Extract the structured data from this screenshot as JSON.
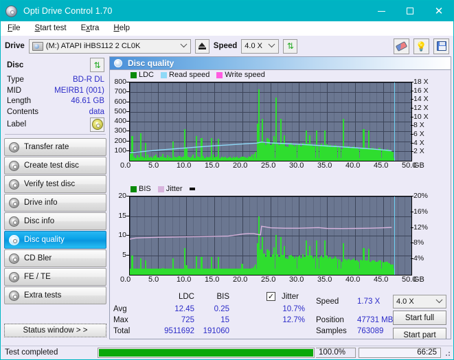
{
  "window": {
    "title": "Opti Drive Control 1.70",
    "icon": "disc-icon",
    "minimize": "–",
    "maximize": "□",
    "close": "✕"
  },
  "menu": {
    "items": [
      "File",
      "Start test",
      "Extra",
      "Help"
    ]
  },
  "toolbar": {
    "drive_label": "Drive",
    "drive_value": "(M:)  ATAPI iHBS112  2 CL0K",
    "eject_icon": "eject-icon",
    "speed_label": "Speed",
    "speed_value": "4.0 X",
    "refresh_icon": "refresh-icon",
    "eraser_icon": "eraser-icon",
    "bulb_icon": "bulb-icon",
    "save_icon": "save-icon"
  },
  "disc": {
    "heading": "Disc",
    "refresh_icon": "refresh-icon",
    "rows": [
      {
        "key": "Type",
        "value": "BD-R DL"
      },
      {
        "key": "MID",
        "value": "MEIRB1 (001)"
      },
      {
        "key": "Length",
        "value": "46.61 GB"
      },
      {
        "key": "Contents",
        "value": "data"
      }
    ],
    "label_key": "Label",
    "label_icon": "cd-disc-icon"
  },
  "nav": {
    "items": [
      {
        "label": "Transfer rate",
        "active": false
      },
      {
        "label": "Create test disc",
        "active": false
      },
      {
        "label": "Verify test disc",
        "active": false
      },
      {
        "label": "Drive info",
        "active": false
      },
      {
        "label": "Disc info",
        "active": false
      },
      {
        "label": "Disc quality",
        "active": true
      },
      {
        "label": "CD Bler",
        "active": false
      },
      {
        "label": "FE / TE",
        "active": false
      },
      {
        "label": "Extra tests",
        "active": false
      }
    ],
    "status_window": "Status window > >"
  },
  "panel": {
    "title": "Disc quality",
    "icon": "disc-quality-icon"
  },
  "stats": {
    "col_ldc": "LDC",
    "col_bis": "BIS",
    "jitter_label": "Jitter",
    "jitter_checked": true,
    "jitter_check_glyph": "✓",
    "row_avg": "Avg",
    "row_max": "Max",
    "row_total": "Total",
    "avg_ldc": "12.45",
    "avg_bis": "0.25",
    "avg_jitter": "10.7%",
    "max_ldc": "725",
    "max_bis": "15",
    "max_jitter": "12.7%",
    "total_ldc": "9511692",
    "total_bis": "191060",
    "speed_label": "Speed",
    "speed_value": "1.73 X",
    "position_label": "Position",
    "position_value": "47731 MB",
    "samples_label": "Samples",
    "samples_value": "763089",
    "speed_select": "4.0 X",
    "start_full": "Start full",
    "start_part": "Start part"
  },
  "statusbar": {
    "text": "Test completed",
    "progress_pct": "100.0%",
    "progress_value": 100,
    "time": "66:25"
  },
  "colors": {
    "accent": "#00b3c3",
    "plot_bg": "#6b7791",
    "ldc_green": "#2fdd2f",
    "read_speed": "#8fd9f7",
    "write_speed": "#ff5ce0",
    "jitter_pink": "#d8b4dd",
    "value_blue": "#2b2bc8",
    "progress_green": "#0aa80a"
  },
  "chart_data": [
    {
      "type": "bar",
      "id": "ldc-chart",
      "title": "Disc quality",
      "xlabel": "GB",
      "ylabel": "LDC",
      "xlim": [
        0,
        50
      ],
      "ylim": [
        0,
        800
      ],
      "y2lim": [
        0,
        18
      ],
      "y2label": "X",
      "xticks": [
        "0.0",
        "5.0",
        "10.0",
        "15.0",
        "20.0",
        "25.0",
        "30.0",
        "35.0",
        "40.0",
        "45.0",
        "50.0"
      ],
      "yticks": [
        100,
        200,
        300,
        400,
        500,
        600,
        700,
        800
      ],
      "y2ticks": [
        "2 X",
        "4 X",
        "6 X",
        "8 X",
        "10 X",
        "12 X",
        "14 X",
        "16 X",
        "18 X"
      ],
      "xunit": "GB",
      "grid": true,
      "legend": [
        {
          "name": "LDC",
          "color": "#0a8a0a",
          "type": "bar"
        },
        {
          "name": "Read speed",
          "color": "#8fd9f7",
          "type": "line"
        },
        {
          "name": "Write speed",
          "color": "#ff5ce0",
          "type": "line"
        }
      ],
      "legend_position": "top-left",
      "series": [
        {
          "name": "LDC",
          "type": "bar",
          "color": "#2fdd2f",
          "x_gb": [
            0.0,
            0.3,
            0.6,
            0.9,
            1.2,
            1.5,
            1.8,
            2.1,
            2.4,
            2.7,
            3.0,
            3.3,
            3.6,
            3.9,
            4.2,
            4.5,
            4.8,
            5.1,
            5.4,
            5.7,
            6.0,
            6.3,
            6.6,
            6.9,
            7.2,
            7.5,
            7.8,
            8.1,
            8.4,
            8.7,
            9.0,
            9.3,
            9.6,
            9.9,
            10.2,
            10.5,
            10.8,
            11.1,
            11.4,
            11.7,
            12.0,
            12.3,
            12.6,
            12.9,
            13.2,
            13.5,
            13.8,
            14.1,
            14.4,
            14.7,
            15.0,
            15.3,
            15.6,
            15.9,
            16.2,
            16.5,
            16.8,
            17.1,
            17.4,
            17.7,
            18.0,
            18.3,
            18.6,
            18.9,
            19.2,
            19.5,
            19.8,
            20.1,
            20.4,
            20.7,
            21.0,
            21.3,
            21.6,
            21.9,
            22.2,
            22.5,
            22.8,
            23.1,
            23.4,
            23.7,
            24.0,
            24.3,
            24.6,
            24.9,
            25.2,
            25.5,
            25.8,
            26.1,
            26.4,
            26.7,
            27.0,
            27.3,
            27.6,
            27.9,
            28.2,
            28.5,
            28.8,
            29.1,
            29.4,
            29.7,
            30.0,
            30.3,
            30.6,
            30.9,
            31.2,
            31.5,
            31.8,
            32.1,
            32.4,
            32.7,
            33.0,
            33.3,
            33.6,
            33.9,
            34.2,
            34.5,
            34.8,
            35.1,
            35.4,
            35.7,
            36.0,
            36.3,
            36.6,
            36.9,
            37.2,
            37.5,
            37.8,
            38.1,
            38.4,
            38.7,
            39.0,
            39.3,
            39.6,
            39.9,
            40.2,
            40.5,
            40.8,
            41.1,
            41.4,
            41.7,
            42.0,
            42.3,
            42.6,
            42.9,
            43.2,
            43.5,
            43.8,
            44.1,
            44.4,
            44.7,
            45.0,
            45.3,
            45.6,
            45.9,
            46.2,
            46.5
          ],
          "values": [
            70,
            250,
            40,
            30,
            55,
            35,
            280,
            45,
            30,
            180,
            60,
            35,
            40,
            30,
            50,
            60,
            35,
            30,
            45,
            70,
            35,
            30,
            55,
            40,
            30,
            200,
            45,
            35,
            40,
            50,
            35,
            40,
            320,
            130,
            45,
            35,
            40,
            60,
            30,
            250,
            40,
            35,
            230,
            50,
            30,
            40,
            35,
            45,
            230,
            60,
            35,
            40,
            225,
            30,
            45,
            35,
            40,
            30,
            35,
            40,
            30,
            45,
            35,
            40,
            30,
            35,
            45,
            40,
            35,
            30,
            40,
            45,
            60,
            70,
            90,
            380,
            730,
            200,
            430,
            190,
            160,
            230,
            215,
            160,
            185,
            250,
            645,
            185,
            160,
            430,
            180,
            260,
            150,
            140,
            175,
            180,
            165,
            150,
            170,
            160,
            175,
            150,
            185,
            160,
            310,
            175,
            260,
            170,
            150,
            165,
            310,
            150,
            160,
            175,
            155,
            310,
            170,
            150,
            160,
            140,
            150,
            165,
            150,
            140,
            130,
            120,
            430,
            140,
            130,
            145,
            125,
            135,
            150,
            125,
            130,
            120,
            135,
            125,
            320,
            130,
            125,
            310,
            120,
            130,
            125,
            115,
            120,
            130,
            125,
            120,
            110,
            115,
            120,
            100,
            95,
            90
          ]
        },
        {
          "name": "Read speed",
          "type": "line",
          "color": "#8fd9f7",
          "x_gb": [
            0,
            2.5,
            5,
            7.5,
            10,
            12.5,
            15,
            17.5,
            20,
            22.5,
            23.4,
            25,
            27.5,
            30,
            32.5,
            35,
            37.5,
            40,
            42.5,
            45,
            46.5
          ],
          "values_x": [
            1.85,
            2.15,
            2.45,
            2.7,
            2.95,
            3.2,
            3.45,
            3.65,
            3.85,
            4.05,
            4.3,
            4.1,
            3.95,
            3.8,
            3.6,
            3.4,
            3.2,
            3.0,
            2.75,
            2.5,
            2.3
          ]
        },
        {
          "name": "Write speed",
          "type": "line",
          "color": "#ff5ce0",
          "x_gb": [],
          "values_x": []
        },
        {
          "name": "End marker",
          "type": "vline",
          "color": "#6fd4f5",
          "x_gb": 46.9
        }
      ]
    },
    {
      "type": "bar",
      "id": "bis-chart",
      "xlabel": "GB",
      "ylabel": "BIS",
      "xlim": [
        0,
        50
      ],
      "ylim": [
        0,
        20
      ],
      "y2lim": [
        0,
        20
      ],
      "y2label": "%",
      "xticks": [
        "0.0",
        "5.0",
        "10.0",
        "15.0",
        "20.0",
        "25.0",
        "30.0",
        "35.0",
        "40.0",
        "45.0",
        "50.0"
      ],
      "yticks": [
        5,
        10,
        15,
        20
      ],
      "y2ticks": [
        "4%",
        "8%",
        "12%",
        "16%",
        "20%"
      ],
      "xunit": "GB",
      "grid": true,
      "legend": [
        {
          "name": "BIS",
          "color": "#0a8a0a",
          "type": "bar"
        },
        {
          "name": "Jitter",
          "color": "#d8b4dd",
          "type": "line"
        }
      ],
      "legend_position": "top-left",
      "series": [
        {
          "name": "BIS",
          "type": "bar",
          "color": "#2fdd2f",
          "x_gb": [
            0.0,
            0.3,
            0.6,
            0.9,
            1.2,
            1.5,
            1.8,
            2.1,
            2.4,
            2.7,
            3.0,
            3.3,
            3.6,
            3.9,
            4.2,
            4.5,
            4.8,
            5.1,
            5.4,
            5.7,
            6.0,
            6.3,
            6.6,
            6.9,
            7.2,
            7.5,
            7.8,
            8.1,
            8.4,
            8.7,
            9.0,
            9.3,
            9.6,
            9.9,
            10.2,
            10.5,
            10.8,
            11.1,
            11.4,
            11.7,
            12.0,
            12.3,
            12.6,
            12.9,
            13.2,
            13.5,
            13.8,
            14.1,
            14.4,
            14.7,
            15.0,
            15.3,
            15.6,
            15.9,
            16.2,
            16.5,
            16.8,
            17.1,
            17.4,
            17.7,
            18.0,
            18.3,
            18.6,
            18.9,
            19.2,
            19.5,
            19.8,
            20.1,
            20.4,
            20.7,
            21.0,
            21.3,
            21.6,
            21.9,
            22.2,
            22.5,
            22.8,
            23.1,
            23.4,
            23.7,
            24.0,
            24.3,
            24.6,
            24.9,
            25.2,
            25.5,
            25.8,
            26.1,
            26.4,
            26.7,
            27.0,
            27.3,
            27.6,
            27.9,
            28.2,
            28.5,
            28.8,
            29.1,
            29.4,
            29.7,
            30.0,
            30.3,
            30.6,
            30.9,
            31.2,
            31.5,
            31.8,
            32.1,
            32.4,
            32.7,
            33.0,
            33.3,
            33.6,
            33.9,
            34.2,
            34.5,
            34.8,
            35.1,
            35.4,
            35.7,
            36.0,
            36.3,
            36.6,
            36.9,
            37.2,
            37.5,
            37.8,
            38.1,
            38.4,
            38.7,
            39.0,
            39.3,
            39.6,
            39.9,
            40.2,
            40.5,
            40.8,
            41.1,
            41.4,
            41.7,
            42.0,
            42.3,
            42.6,
            42.9,
            43.2,
            43.5,
            43.8,
            44.1,
            44.4,
            44.7,
            45.0,
            45.3,
            45.6,
            45.9,
            46.2,
            46.5
          ],
          "values": [
            1.2,
            5.0,
            1.3,
            1.1,
            1.4,
            1.2,
            4.3,
            1.3,
            1.1,
            3.6,
            1.5,
            1.2,
            1.3,
            1.1,
            1.4,
            1.6,
            1.2,
            1.1,
            1.3,
            1.7,
            1.2,
            1.1,
            1.4,
            1.3,
            1.1,
            4.3,
            1.4,
            1.2,
            1.3,
            1.5,
            1.2,
            1.3,
            6.8,
            2.5,
            1.3,
            1.2,
            1.3,
            1.6,
            1.1,
            4.7,
            1.3,
            1.2,
            4.6,
            1.5,
            1.1,
            1.3,
            1.2,
            1.4,
            4.6,
            1.6,
            1.2,
            1.3,
            4.5,
            1.1,
            1.4,
            1.2,
            1.3,
            1.1,
            1.2,
            1.3,
            1.1,
            1.4,
            1.2,
            1.3,
            1.1,
            1.2,
            2.8,
            1.4,
            1.3,
            1.1,
            1.4,
            1.5,
            1.8,
            2.1,
            2.6,
            8.0,
            15.0,
            6.5,
            9.6,
            5.5,
            4.6,
            6.5,
            6.1,
            4.5,
            5.2,
            7.0,
            10.2,
            5.2,
            4.6,
            9.6,
            5.1,
            7.3,
            4.3,
            4.0,
            5.0,
            5.1,
            4.7,
            4.3,
            4.8,
            4.6,
            5.0,
            4.3,
            5.2,
            4.6,
            8.8,
            5.0,
            7.4,
            4.9,
            4.3,
            4.7,
            8.8,
            4.3,
            4.6,
            5.0,
            4.4,
            8.8,
            4.9,
            4.3,
            4.6,
            4.0,
            4.3,
            4.7,
            4.3,
            4.0,
            3.7,
            3.4,
            8.0,
            4.0,
            3.7,
            4.1,
            3.6,
            3.9,
            4.3,
            3.6,
            3.7,
            3.4,
            3.9,
            3.6,
            6.8,
            3.7,
            3.6,
            6.6,
            3.4,
            3.7,
            3.6,
            3.3,
            3.4,
            3.7,
            3.6,
            3.4,
            3.1,
            3.3,
            3.4,
            2.9,
            2.7,
            2.6
          ]
        },
        {
          "name": "Jitter",
          "type": "line",
          "color": "#d8b4dd",
          "x_gb": [
            0,
            1,
            2.5,
            5,
            7.5,
            10,
            12.5,
            15,
            17.5,
            19,
            20,
            21,
            22,
            23.2,
            23.4,
            25,
            27.5,
            30,
            32.5,
            33.5,
            35,
            37.5,
            40,
            42.5,
            45,
            46.5
          ],
          "values_pct": [
            9.1,
            9.4,
            9.5,
            9.6,
            9.65,
            9.7,
            9.75,
            9.8,
            9.9,
            10.2,
            10.4,
            10.5,
            10.5,
            10.2,
            12.4,
            12.0,
            11.9,
            11.9,
            12.0,
            12.05,
            11.85,
            11.8,
            11.85,
            11.9,
            12.0,
            12.1
          ]
        },
        {
          "name": "End marker",
          "type": "vline",
          "color": "#6fd4f5",
          "x_gb": 46.9
        }
      ]
    }
  ]
}
